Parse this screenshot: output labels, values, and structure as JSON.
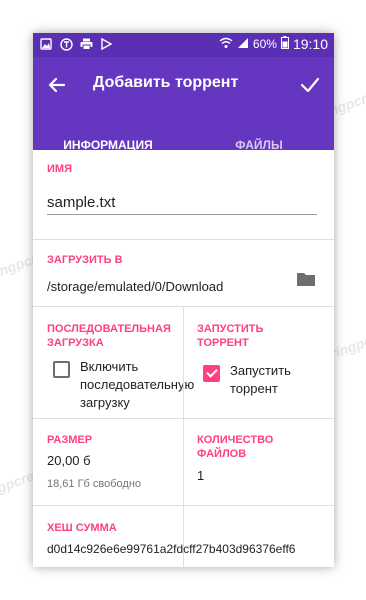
{
  "status_bar": {
    "battery": "60%",
    "time": "19:10"
  },
  "toolbar": {
    "title": "Добавить торрент"
  },
  "tabs": [
    {
      "label": "ИНФОРМАЦИЯ",
      "active": true
    },
    {
      "label": "ФАЙЛЫ",
      "active": false
    }
  ],
  "name_section": {
    "label": "ИМЯ",
    "value": "sample.txt"
  },
  "download_section": {
    "label": "ЗАГРУЗИТЬ В",
    "path": "/storage/emulated/0/Download"
  },
  "sequential_section": {
    "label": "ПОСЛЕДОВАТЕЛЬНАЯ ЗАГРУЗКА",
    "checkbox_label": "Включить последовательную загрузку",
    "checked": false
  },
  "start_section": {
    "label": "ЗАПУСТИТЬ ТОРРЕНТ",
    "checkbox_label": "Запустить торрент",
    "checked": true
  },
  "size_section": {
    "label": "РАЗМЕР",
    "value": "20,00 б",
    "free": "18,61 Гб свободно"
  },
  "files_count_section": {
    "label": "КОЛИЧЕСТВО ФАЙЛОВ",
    "value": "1"
  },
  "hash_section": {
    "label": "ХЕШ СУММА",
    "value": "d0d14c926e6e99761a2fdcff27b403d96376eff6"
  },
  "colors": {
    "primary": "#6537c0",
    "status_bar": "#5b2fb3",
    "accent": "#ff4081",
    "tab_indicator": "#ff6d96"
  },
  "watermark_text": "Soringpcrepair.com"
}
